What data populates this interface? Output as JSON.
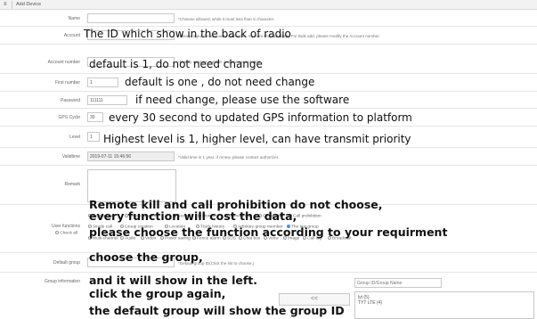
{
  "titlebar": {
    "menu_icon": "≡",
    "title": "Add Device"
  },
  "fields": {
    "name": {
      "label": "Name",
      "value": "",
      "hint": "*Chinese allowed, while it must less than 8 character."
    },
    "account": {
      "label": "Account",
      "value": "",
      "hint": "*Please input the account information, no more than 12 digits. For Bulk add, please modify the Account number."
    },
    "account_number": {
      "label": "Account number",
      "value": "",
      "hint": "*Modify account number and not exceed 200!"
    },
    "first_number": {
      "label": "First number",
      "value": "1"
    },
    "password": {
      "label": "Password",
      "value": "111111"
    },
    "gps_cycle": {
      "label": "GPS Cycle",
      "value": "30"
    },
    "level": {
      "label": "Level",
      "value": "1"
    },
    "validtime": {
      "label": "Validtime",
      "value": "2019-07-11 15:46:56",
      "hint": "*Valid time is 1 year, if renew, please contact authorizer."
    },
    "remark": {
      "label": "Remark",
      "value": ""
    },
    "user_functions": {
      "label": "User functions",
      "check_all": "Check all",
      "options": [
        "Contact list",
        "Check location",
        "Record",
        "Monitor",
        "Remote kill",
        "Group call",
        "Call prohibition"
      ],
      "options2": [
        "Single call",
        "Group creation",
        "Location",
        "Track history",
        "Arbitrary group member",
        "The last group"
      ],
      "options3": [
        "Multi-channel",
        "Audio",
        "Video",
        "Power saving",
        "Fence alarm",
        "SOS",
        "Chat box",
        "Voice",
        "Image",
        "Call log",
        "Broadcast"
      ],
      "checked_label": "The last group"
    },
    "default_group": {
      "label": "Default group",
      "value": "",
      "hint": "*Default group ID(Click the list to choose.)"
    },
    "group_information": {
      "label": "Group information",
      "search_placeholder": "Group ID/Group Name",
      "move_left": "<<",
      "items": [
        "lyt (5)",
        "TYT LTE (4)"
      ]
    }
  },
  "annotations": {
    "account": "The ID which show in the back of radio",
    "account_number": "default is 1, do not need change",
    "first_number": "default is one , do not need change",
    "password": "if need change, please use the software",
    "gps_cycle": "every 30 second to updated GPS information to platform",
    "level": "Highest level is 1, higher level, can have transmit priority",
    "functions_1": "Remote kill and call prohibition do not choose,",
    "functions_2": "every function will cost the data,",
    "functions_3": "please choose the function according to your requirment",
    "group_1": "choose the group,",
    "group_2": "and it will show in the left.",
    "group_3": "click the group again,",
    "group_4": "the default group will show the group ID"
  }
}
